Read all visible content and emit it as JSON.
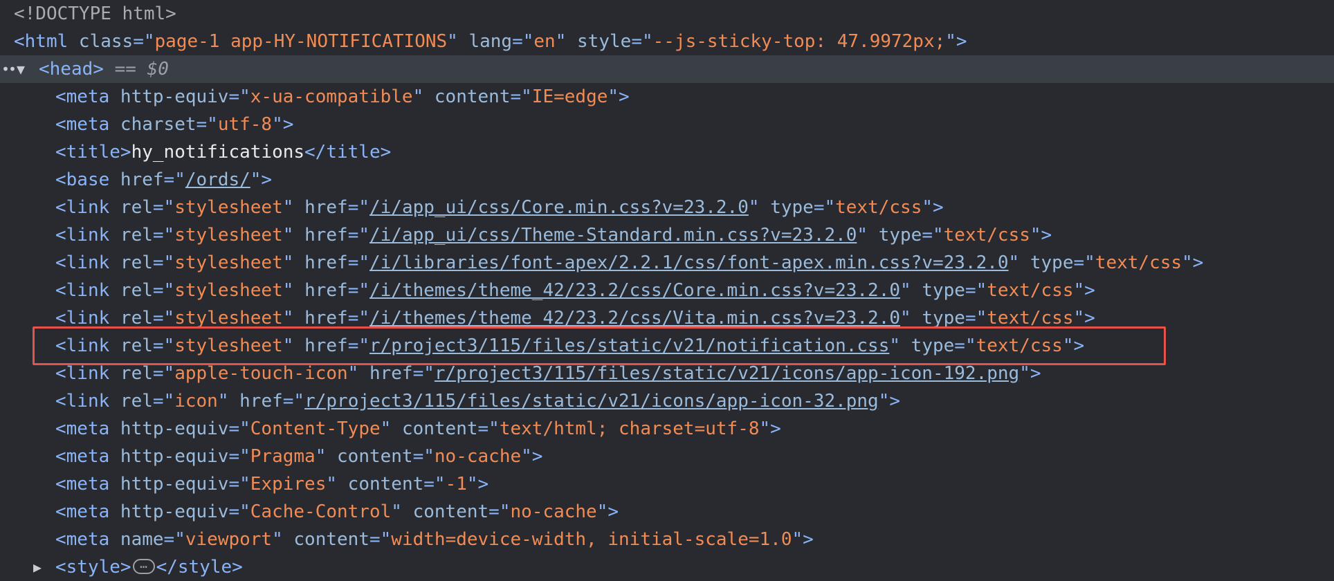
{
  "lines": [
    {
      "indent": 0,
      "tokens": [
        {
          "t": "doctype",
          "v": "<!DOCTYPE html>"
        }
      ]
    },
    {
      "indent": 0,
      "tokens": [
        {
          "t": "tag",
          "v": "<html "
        },
        {
          "t": "attr",
          "v": "class"
        },
        {
          "t": "tag",
          "v": "=\""
        },
        {
          "t": "val",
          "v": "page-1 app-HY-NOTIFICATIONS"
        },
        {
          "t": "tag",
          "v": "\" "
        },
        {
          "t": "attr",
          "v": "lang"
        },
        {
          "t": "tag",
          "v": "=\""
        },
        {
          "t": "val",
          "v": "en"
        },
        {
          "t": "tag",
          "v": "\" "
        },
        {
          "t": "attr",
          "v": "style"
        },
        {
          "t": "tag",
          "v": "=\""
        },
        {
          "t": "val",
          "v": "--js-sticky-top: 47.9972px;"
        },
        {
          "t": "tag",
          "v": "\">"
        }
      ]
    },
    {
      "indent": 1,
      "selected": true,
      "caret": "▼",
      "tokens": [
        {
          "t": "tag",
          "v": "<head>"
        },
        {
          "t": "eq",
          "v": " == "
        },
        {
          "t": "sel",
          "v": "$0"
        }
      ]
    },
    {
      "indent": 2,
      "tokens": [
        {
          "t": "tag",
          "v": "<meta "
        },
        {
          "t": "attr",
          "v": "http-equiv"
        },
        {
          "t": "tag",
          "v": "=\""
        },
        {
          "t": "val",
          "v": "x-ua-compatible"
        },
        {
          "t": "tag",
          "v": "\" "
        },
        {
          "t": "attr",
          "v": "content"
        },
        {
          "t": "tag",
          "v": "=\""
        },
        {
          "t": "val",
          "v": "IE=edge"
        },
        {
          "t": "tag",
          "v": "\">"
        }
      ]
    },
    {
      "indent": 2,
      "tokens": [
        {
          "t": "tag",
          "v": "<meta "
        },
        {
          "t": "attr",
          "v": "charset"
        },
        {
          "t": "tag",
          "v": "=\""
        },
        {
          "t": "val",
          "v": "utf-8"
        },
        {
          "t": "tag",
          "v": "\">"
        }
      ]
    },
    {
      "indent": 2,
      "tokens": [
        {
          "t": "tag",
          "v": "<title>"
        },
        {
          "t": "text",
          "v": "hy_notifications"
        },
        {
          "t": "tag",
          "v": "</title>"
        }
      ]
    },
    {
      "indent": 2,
      "tokens": [
        {
          "t": "tag",
          "v": "<base "
        },
        {
          "t": "attr",
          "v": "href"
        },
        {
          "t": "tag",
          "v": "=\""
        },
        {
          "t": "link",
          "v": "/ords/"
        },
        {
          "t": "tag",
          "v": "\">"
        }
      ]
    },
    {
      "indent": 2,
      "tokens": [
        {
          "t": "tag",
          "v": "<link "
        },
        {
          "t": "attr",
          "v": "rel"
        },
        {
          "t": "tag",
          "v": "=\""
        },
        {
          "t": "val",
          "v": "stylesheet"
        },
        {
          "t": "tag",
          "v": "\" "
        },
        {
          "t": "attr",
          "v": "href"
        },
        {
          "t": "tag",
          "v": "=\""
        },
        {
          "t": "link",
          "v": "/i/app_ui/css/Core.min.css?v=23.2.0"
        },
        {
          "t": "tag",
          "v": "\" "
        },
        {
          "t": "attr",
          "v": "type"
        },
        {
          "t": "tag",
          "v": "=\""
        },
        {
          "t": "val",
          "v": "text/css"
        },
        {
          "t": "tag",
          "v": "\">"
        }
      ]
    },
    {
      "indent": 2,
      "tokens": [
        {
          "t": "tag",
          "v": "<link "
        },
        {
          "t": "attr",
          "v": "rel"
        },
        {
          "t": "tag",
          "v": "=\""
        },
        {
          "t": "val",
          "v": "stylesheet"
        },
        {
          "t": "tag",
          "v": "\" "
        },
        {
          "t": "attr",
          "v": "href"
        },
        {
          "t": "tag",
          "v": "=\""
        },
        {
          "t": "link",
          "v": "/i/app_ui/css/Theme-Standard.min.css?v=23.2.0"
        },
        {
          "t": "tag",
          "v": "\" "
        },
        {
          "t": "attr",
          "v": "type"
        },
        {
          "t": "tag",
          "v": "=\""
        },
        {
          "t": "val",
          "v": "text/css"
        },
        {
          "t": "tag",
          "v": "\">"
        }
      ]
    },
    {
      "indent": 2,
      "tokens": [
        {
          "t": "tag",
          "v": "<link "
        },
        {
          "t": "attr",
          "v": "rel"
        },
        {
          "t": "tag",
          "v": "=\""
        },
        {
          "t": "val",
          "v": "stylesheet"
        },
        {
          "t": "tag",
          "v": "\" "
        },
        {
          "t": "attr",
          "v": "href"
        },
        {
          "t": "tag",
          "v": "=\""
        },
        {
          "t": "link",
          "v": "/i/libraries/font-apex/2.2.1/css/font-apex.min.css?v=23.2.0"
        },
        {
          "t": "tag",
          "v": "\" "
        },
        {
          "t": "attr",
          "v": "type"
        },
        {
          "t": "tag",
          "v": "=\""
        },
        {
          "t": "val",
          "v": "text/css"
        },
        {
          "t": "tag",
          "v": "\">"
        }
      ]
    },
    {
      "indent": 2,
      "tokens": [
        {
          "t": "tag",
          "v": "<link "
        },
        {
          "t": "attr",
          "v": "rel"
        },
        {
          "t": "tag",
          "v": "=\""
        },
        {
          "t": "val",
          "v": "stylesheet"
        },
        {
          "t": "tag",
          "v": "\" "
        },
        {
          "t": "attr",
          "v": "href"
        },
        {
          "t": "tag",
          "v": "=\""
        },
        {
          "t": "link",
          "v": "/i/themes/theme_42/23.2/css/Core.min.css?v=23.2.0"
        },
        {
          "t": "tag",
          "v": "\" "
        },
        {
          "t": "attr",
          "v": "type"
        },
        {
          "t": "tag",
          "v": "=\""
        },
        {
          "t": "val",
          "v": "text/css"
        },
        {
          "t": "tag",
          "v": "\">"
        }
      ]
    },
    {
      "indent": 2,
      "tokens": [
        {
          "t": "tag",
          "v": "<link "
        },
        {
          "t": "attr",
          "v": "rel"
        },
        {
          "t": "tag",
          "v": "=\""
        },
        {
          "t": "val",
          "v": "stylesheet"
        },
        {
          "t": "tag",
          "v": "\" "
        },
        {
          "t": "attr",
          "v": "href"
        },
        {
          "t": "tag",
          "v": "=\""
        },
        {
          "t": "link",
          "v": "/i/themes/theme_42/23.2/css/Vita.min.css?v=23.2.0"
        },
        {
          "t": "tag",
          "v": "\" "
        },
        {
          "t": "attr",
          "v": "type"
        },
        {
          "t": "tag",
          "v": "=\""
        },
        {
          "t": "val",
          "v": "text/css"
        },
        {
          "t": "tag",
          "v": "\">"
        }
      ]
    },
    {
      "indent": 2,
      "highlighted": true,
      "tokens": [
        {
          "t": "tag",
          "v": "<link "
        },
        {
          "t": "attr",
          "v": "rel"
        },
        {
          "t": "tag",
          "v": "=\""
        },
        {
          "t": "val",
          "v": "stylesheet"
        },
        {
          "t": "tag",
          "v": "\" "
        },
        {
          "t": "attr",
          "v": "href"
        },
        {
          "t": "tag",
          "v": "=\""
        },
        {
          "t": "link",
          "v": "r/project3/115/files/static/v21/notification.css"
        },
        {
          "t": "tag",
          "v": "\" "
        },
        {
          "t": "attr",
          "v": "type"
        },
        {
          "t": "tag",
          "v": "=\""
        },
        {
          "t": "val",
          "v": "text/css"
        },
        {
          "t": "tag",
          "v": "\">"
        }
      ]
    },
    {
      "indent": 2,
      "tokens": [
        {
          "t": "tag",
          "v": "<link "
        },
        {
          "t": "attr",
          "v": "rel"
        },
        {
          "t": "tag",
          "v": "=\""
        },
        {
          "t": "val",
          "v": "apple-touch-icon"
        },
        {
          "t": "tag",
          "v": "\" "
        },
        {
          "t": "attr",
          "v": "href"
        },
        {
          "t": "tag",
          "v": "=\""
        },
        {
          "t": "link",
          "v": "r/project3/115/files/static/v21/icons/app-icon-192.png"
        },
        {
          "t": "tag",
          "v": "\">"
        }
      ]
    },
    {
      "indent": 2,
      "tokens": [
        {
          "t": "tag",
          "v": "<link "
        },
        {
          "t": "attr",
          "v": "rel"
        },
        {
          "t": "tag",
          "v": "=\""
        },
        {
          "t": "val",
          "v": "icon"
        },
        {
          "t": "tag",
          "v": "\" "
        },
        {
          "t": "attr",
          "v": "href"
        },
        {
          "t": "tag",
          "v": "=\""
        },
        {
          "t": "link",
          "v": "r/project3/115/files/static/v21/icons/app-icon-32.png"
        },
        {
          "t": "tag",
          "v": "\">"
        }
      ]
    },
    {
      "indent": 2,
      "tokens": [
        {
          "t": "tag",
          "v": "<meta "
        },
        {
          "t": "attr",
          "v": "http-equiv"
        },
        {
          "t": "tag",
          "v": "=\""
        },
        {
          "t": "val",
          "v": "Content-Type"
        },
        {
          "t": "tag",
          "v": "\" "
        },
        {
          "t": "attr",
          "v": "content"
        },
        {
          "t": "tag",
          "v": "=\""
        },
        {
          "t": "val",
          "v": "text/html; charset=utf-8"
        },
        {
          "t": "tag",
          "v": "\">"
        }
      ]
    },
    {
      "indent": 2,
      "tokens": [
        {
          "t": "tag",
          "v": "<meta "
        },
        {
          "t": "attr",
          "v": "http-equiv"
        },
        {
          "t": "tag",
          "v": "=\""
        },
        {
          "t": "val",
          "v": "Pragma"
        },
        {
          "t": "tag",
          "v": "\" "
        },
        {
          "t": "attr",
          "v": "content"
        },
        {
          "t": "tag",
          "v": "=\""
        },
        {
          "t": "val",
          "v": "no-cache"
        },
        {
          "t": "tag",
          "v": "\">"
        }
      ]
    },
    {
      "indent": 2,
      "tokens": [
        {
          "t": "tag",
          "v": "<meta "
        },
        {
          "t": "attr",
          "v": "http-equiv"
        },
        {
          "t": "tag",
          "v": "=\""
        },
        {
          "t": "val",
          "v": "Expires"
        },
        {
          "t": "tag",
          "v": "\" "
        },
        {
          "t": "attr",
          "v": "content"
        },
        {
          "t": "tag",
          "v": "=\""
        },
        {
          "t": "val",
          "v": "-1"
        },
        {
          "t": "tag",
          "v": "\">"
        }
      ]
    },
    {
      "indent": 2,
      "tokens": [
        {
          "t": "tag",
          "v": "<meta "
        },
        {
          "t": "attr",
          "v": "http-equiv"
        },
        {
          "t": "tag",
          "v": "=\""
        },
        {
          "t": "val",
          "v": "Cache-Control"
        },
        {
          "t": "tag",
          "v": "\" "
        },
        {
          "t": "attr",
          "v": "content"
        },
        {
          "t": "tag",
          "v": "=\""
        },
        {
          "t": "val",
          "v": "no-cache"
        },
        {
          "t": "tag",
          "v": "\">"
        }
      ]
    },
    {
      "indent": 2,
      "tokens": [
        {
          "t": "tag",
          "v": "<meta "
        },
        {
          "t": "attr",
          "v": "name"
        },
        {
          "t": "tag",
          "v": "=\""
        },
        {
          "t": "val",
          "v": "viewport"
        },
        {
          "t": "tag",
          "v": "\" "
        },
        {
          "t": "attr",
          "v": "content"
        },
        {
          "t": "tag",
          "v": "=\""
        },
        {
          "t": "val",
          "v": "width=device-width, initial-scale=1.0"
        },
        {
          "t": "tag",
          "v": "\">"
        }
      ]
    },
    {
      "indent": 2,
      "caret": "▶",
      "tokens": [
        {
          "t": "tag",
          "v": "<style>"
        },
        {
          "t": "ellipsis",
          "v": "…"
        },
        {
          "t": "tag",
          "v": "</style>"
        }
      ]
    }
  ],
  "gutter_marker": "••",
  "colors": {
    "background": "#282a2f",
    "selected_row": "#3a3e45",
    "tag": "#8ab4f8",
    "attribute_value": "#f28b54",
    "highlight_border": "#e5534b"
  }
}
